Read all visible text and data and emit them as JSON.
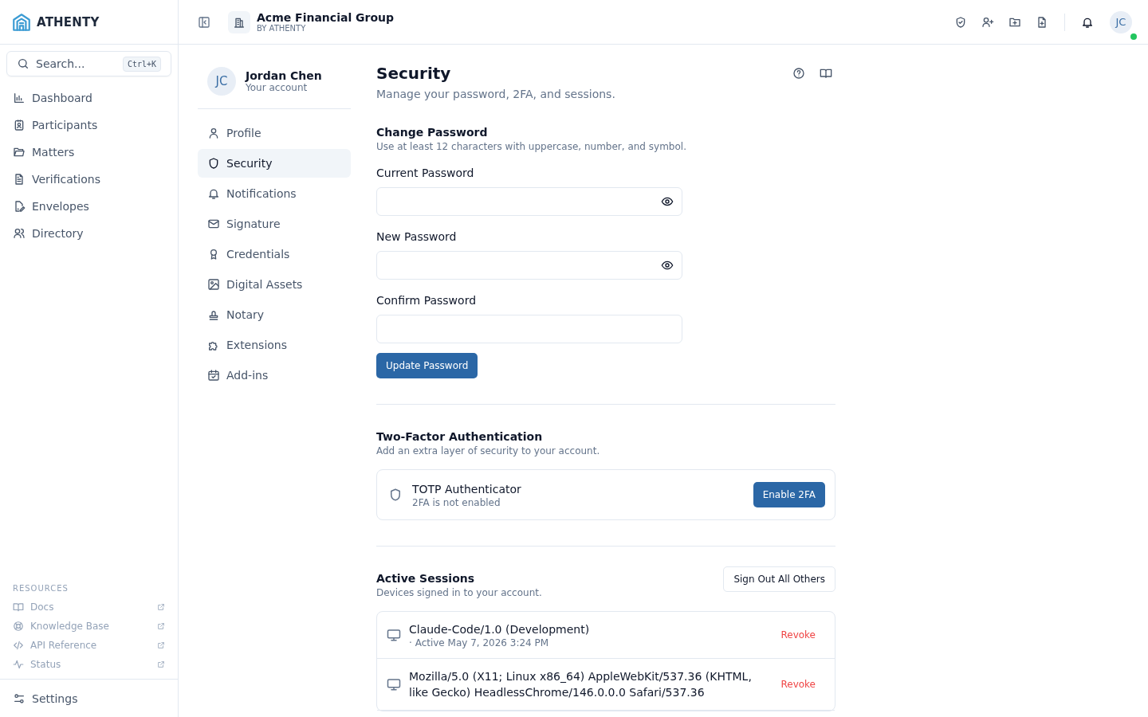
{
  "brand": {
    "name": "ATHENTY"
  },
  "search": {
    "placeholder": "Search...",
    "shortcut": "Ctrl+K"
  },
  "sidebar": {
    "items": [
      {
        "label": "Dashboard"
      },
      {
        "label": "Participants"
      },
      {
        "label": "Matters"
      },
      {
        "label": "Verifications"
      },
      {
        "label": "Envelopes"
      },
      {
        "label": "Directory"
      }
    ],
    "resources": {
      "heading": "RESOURCES",
      "items": [
        {
          "label": "Docs"
        },
        {
          "label": "Knowledge Base"
        },
        {
          "label": "API Reference"
        },
        {
          "label": "Status"
        }
      ]
    },
    "footer": {
      "label": "Settings"
    }
  },
  "topbar": {
    "org": "Acme Financial Group",
    "org_sub": "BY ATHENTY",
    "avatar": "JC",
    "online": true
  },
  "account": {
    "initials": "JC",
    "name": "Jordan Chen",
    "subtitle": "Your account"
  },
  "settings_nav": [
    {
      "label": "Profile",
      "selected": false
    },
    {
      "label": "Security",
      "selected": true
    },
    {
      "label": "Notifications",
      "selected": false
    },
    {
      "label": "Signature",
      "selected": false
    },
    {
      "label": "Credentials",
      "selected": false
    },
    {
      "label": "Digital Assets",
      "selected": false
    },
    {
      "label": "Notary",
      "selected": false
    },
    {
      "label": "Extensions",
      "selected": false
    },
    {
      "label": "Add-ins",
      "selected": false
    }
  ],
  "page": {
    "title": "Security",
    "subtitle": "Manage your password, 2FA, and sessions."
  },
  "password": {
    "title": "Change Password",
    "hint": "Use at least 12 characters with uppercase, number, and symbol.",
    "fields": [
      {
        "label": "Current Password",
        "reveal_toggle": true
      },
      {
        "label": "New Password",
        "reveal_toggle": true
      },
      {
        "label": "Confirm Password",
        "reveal_toggle": false
      }
    ],
    "button": "Update Password"
  },
  "two_factor": {
    "title": "Two-Factor Authentication",
    "hint": "Add an extra layer of security to your account.",
    "method": "TOTP Authenticator",
    "status": "2FA is not enabled",
    "button": "Enable 2FA"
  },
  "sessions": {
    "title": "Active Sessions",
    "hint": "Devices signed in to your account.",
    "button": "Sign Out All Others",
    "items": [
      {
        "agent": "Claude-Code/1.0 (Development)",
        "active": "· Active May 7, 2026 3:24 PM",
        "action": "Revoke"
      },
      {
        "agent": "Mozilla/5.0 (X11; Linux x86_64) AppleWebKit/537.36 (KHTML, like Gecko) HeadlessChrome/146.0.0.0 Safari/537.36",
        "action": "Revoke"
      }
    ]
  }
}
